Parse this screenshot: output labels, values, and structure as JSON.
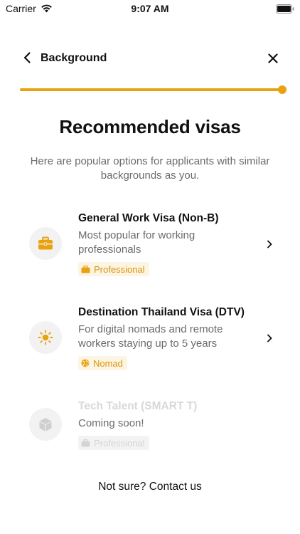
{
  "status_bar": {
    "carrier": "Carrier",
    "time": "9:07 AM"
  },
  "header": {
    "title": "Background",
    "back_icon": "chevron-left-icon",
    "close_icon": "close-icon"
  },
  "progress": {
    "value": 1.0,
    "color": "#e8a20f",
    "track_color": "#f3e3bd"
  },
  "main": {
    "title": "Recommended visas",
    "subtitle": "Here are popular options for applicants with similar backgrounds as you."
  },
  "visas": [
    {
      "title": "General Work Visa (Non-B)",
      "description": "Most popular for working professionals",
      "tag": "Professional",
      "icon": "briefcase-icon",
      "tag_icon": "briefcase-icon",
      "enabled": true
    },
    {
      "title": "Destination Thailand Visa (DTV)",
      "description": "For digital nomads and remote workers staying up to 5 years",
      "tag": "Nomad",
      "icon": "sun-icon",
      "tag_icon": "globe-icon",
      "enabled": true
    },
    {
      "title": "Tech Talent (SMART T)",
      "description": "Coming soon!",
      "tag": "Professional",
      "icon": "cube-icon",
      "tag_icon": "briefcase-icon",
      "enabled": false
    }
  ],
  "footer": {
    "prompt": "Not sure?",
    "link": "Contact us"
  },
  "colors": {
    "accent": "#e8a20f",
    "muted_text": "#6b6b6b",
    "tag_bg": "#fdf5e3"
  }
}
